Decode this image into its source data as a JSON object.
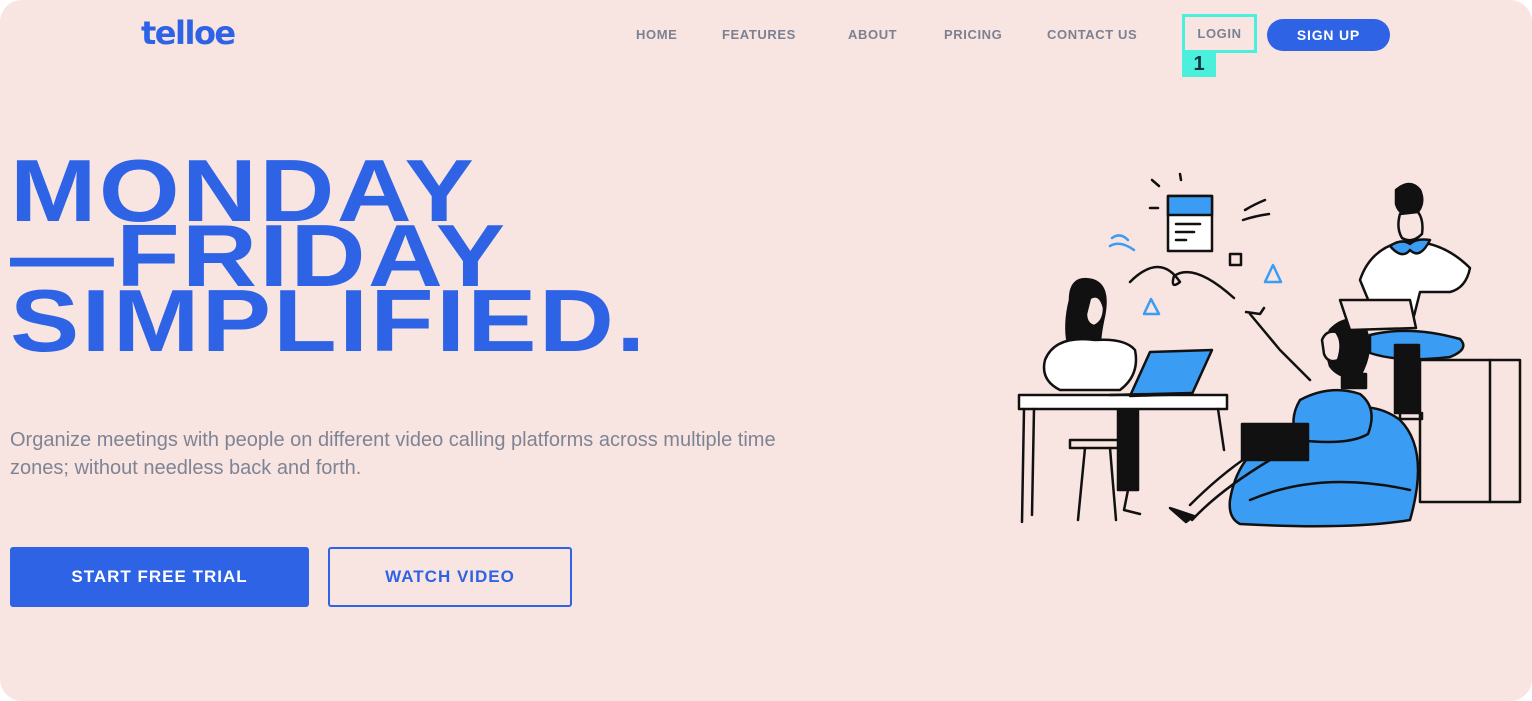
{
  "header": {
    "logo": "telloe",
    "nav": [
      "HOME",
      "FEATURES",
      "ABOUT",
      "PRICING",
      "CONTACT US"
    ],
    "login": "LOGIN",
    "login_badge": "1",
    "signup": "SIGN UP"
  },
  "hero": {
    "headline": [
      "MONDAY",
      "—FRIDAY",
      "SIMPLIFIED."
    ],
    "subtitle": "Organize meetings with people on different video calling platforms across multiple time zones; without needless back and forth.",
    "cta_primary": "START FREE TRIAL",
    "cta_secondary": "WATCH VIDEO"
  },
  "illustration": {
    "icons": [
      "people-working-illustration"
    ]
  },
  "colors": {
    "accent": "#2e63e6",
    "background": "#f8e4e1",
    "nav_text": "#7c8192",
    "highlight": "#4bf0dd",
    "illustration_blue": "#3b9cf3"
  }
}
